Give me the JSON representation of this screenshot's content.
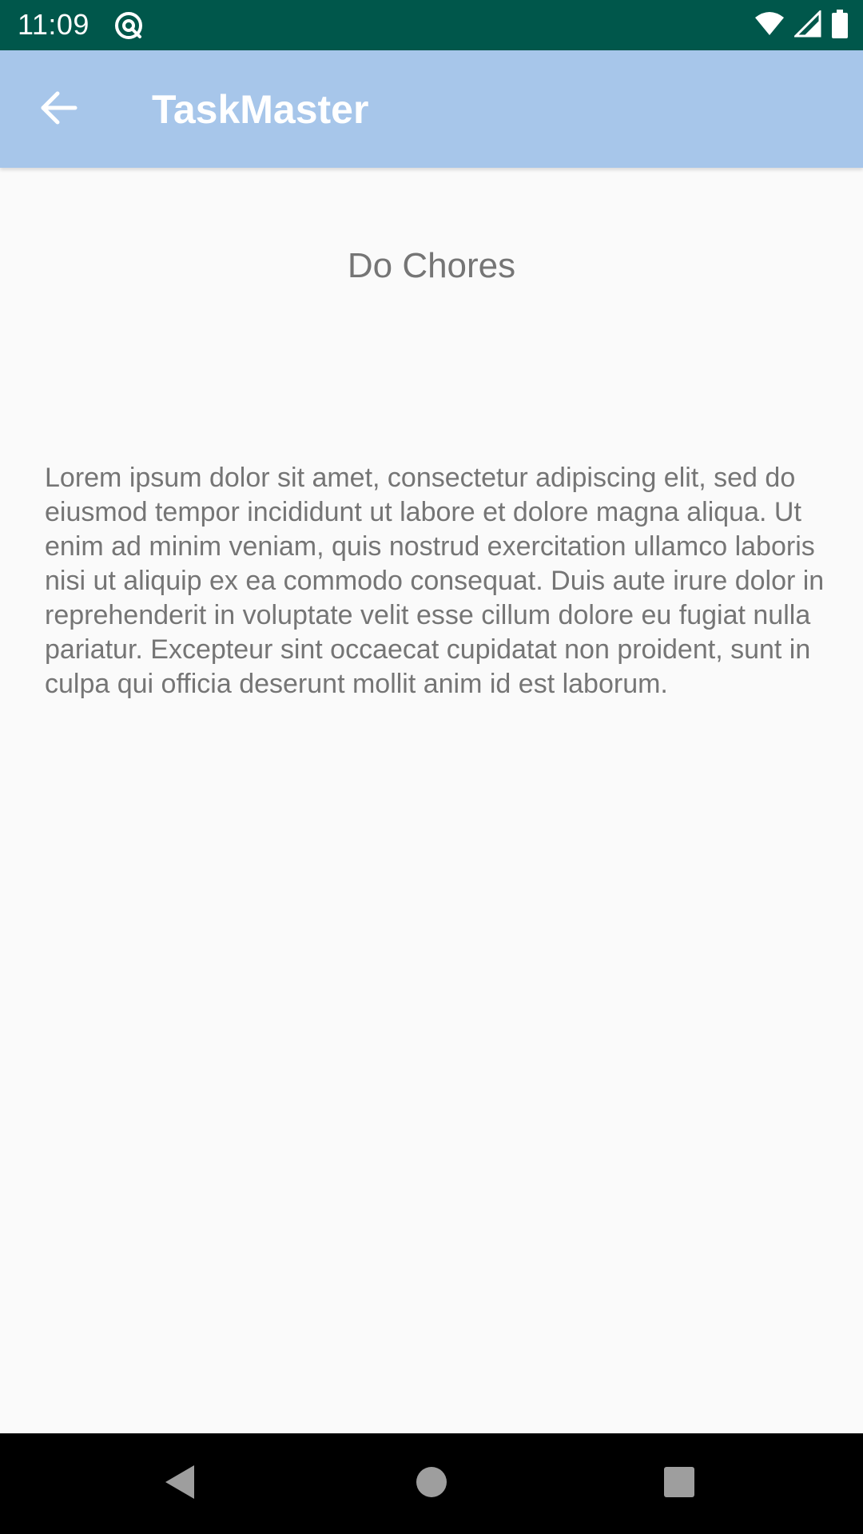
{
  "status_bar": {
    "time": "11:09",
    "icons": [
      "at-sign-icon",
      "wifi-icon",
      "signal-icon",
      "battery-icon"
    ]
  },
  "app_bar": {
    "title": "TaskMaster",
    "back_icon": "back-arrow-icon",
    "background_color": "#a7c6ea"
  },
  "task": {
    "title": "Do Chores",
    "body": "Lorem ipsum dolor sit amet, consectetur adipiscing elit, sed do eiusmod tempor incididunt ut labore et dolore magna aliqua. Ut enim ad minim veniam, quis nostrud exercitation ullamco laboris nisi ut aliquip ex ea commodo consequat. Duis aute irure dolor in reprehenderit in voluptate velit esse cillum dolore eu fugiat nulla pariatur. Excepteur sint occaecat cupidatat non proident, sunt in culpa qui officia deserunt mollit anim id est laborum."
  },
  "nav_bar": {
    "icons": [
      "nav-back-icon",
      "nav-home-icon",
      "nav-recents-icon"
    ]
  },
  "colors": {
    "status_bar": "#00574b",
    "text": "#757575",
    "background": "#fafafa"
  }
}
